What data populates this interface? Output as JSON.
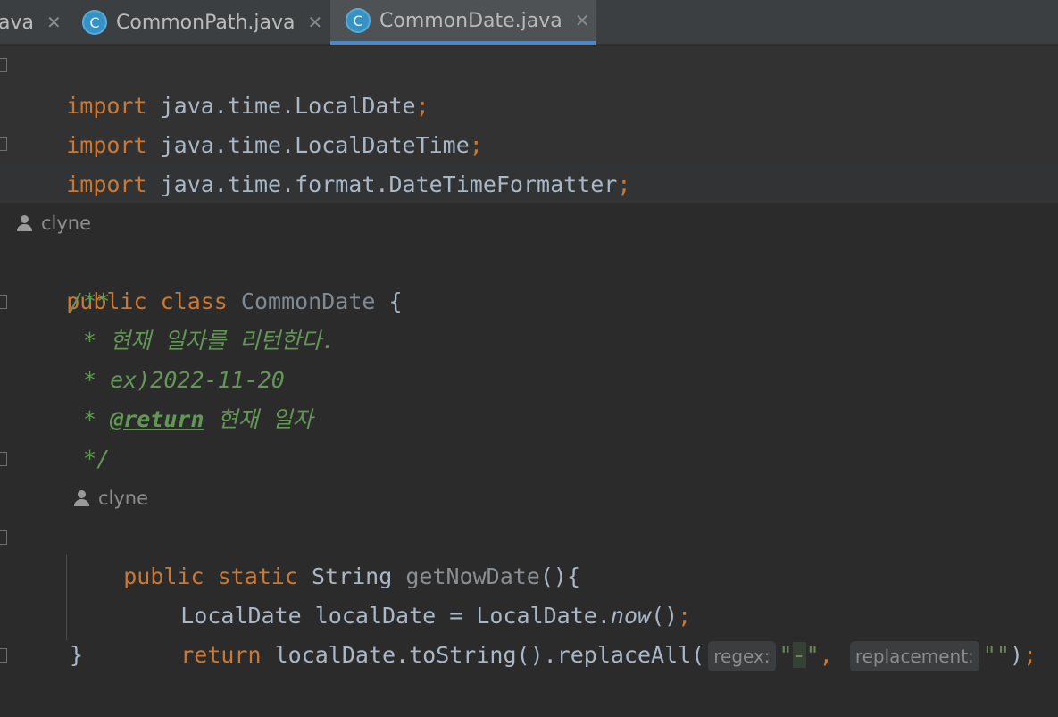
{
  "tabs": [
    {
      "label": "ava",
      "icon": "",
      "active": false
    },
    {
      "label": "CommonPath.java",
      "icon": "C",
      "active": false
    },
    {
      "label": "CommonDate.java",
      "icon": "C",
      "active": true
    }
  ],
  "tab_close_glyph": "✕",
  "code": {
    "import1": {
      "kw": "import",
      "path": "java.time.LocalDate",
      "semi": ";"
    },
    "import2": {
      "kw": "import",
      "path": "java.time.LocalDateTime",
      "semi": ";"
    },
    "import3": {
      "kw": "import",
      "path": "java.time.format.DateTimeFormatter",
      "semi": ";"
    },
    "author1": "clyne",
    "class_decl": {
      "kw1": "public",
      "kw2": "class",
      "name": "CommonDate",
      "brace": " {"
    },
    "doc": {
      "open": "/**",
      "line1": " * 현재 일자를 리턴한다.",
      "line2": " * ex)2022-11-20",
      "line3_prefix": " * ",
      "line3_tag": "@return",
      "line3_text": " 현재 일자",
      "close": " */"
    },
    "author2": "clyne",
    "method_decl": {
      "kw1": "public",
      "kw2": "static",
      "type": "String",
      "name": "getNowDate",
      "rest": "(){"
    },
    "body1": {
      "type": "LocalDate",
      "var": "localDate",
      "eq": " = ",
      "cls": "LocalDate",
      "dot": ".",
      "call": "now",
      "paren": "()",
      "semi": ";"
    },
    "body2": {
      "kw": "return",
      "expr": "localDate.toString().replaceAll(",
      "hint1": "regex:",
      "q1": "\"",
      "dash": "-",
      "q2": "\"",
      "comma": ", ",
      "hint2": "replacement:",
      "str2": "\"\"",
      "close": ")",
      "semi": ";"
    },
    "method_close": "}"
  },
  "colors": {
    "background": "#2b2b2b",
    "keyword": "#cc7832",
    "identifier": "#a9b7c6",
    "doc_comment": "#629755",
    "string": "#6a8759",
    "tab_accent": "#4a88c7"
  }
}
